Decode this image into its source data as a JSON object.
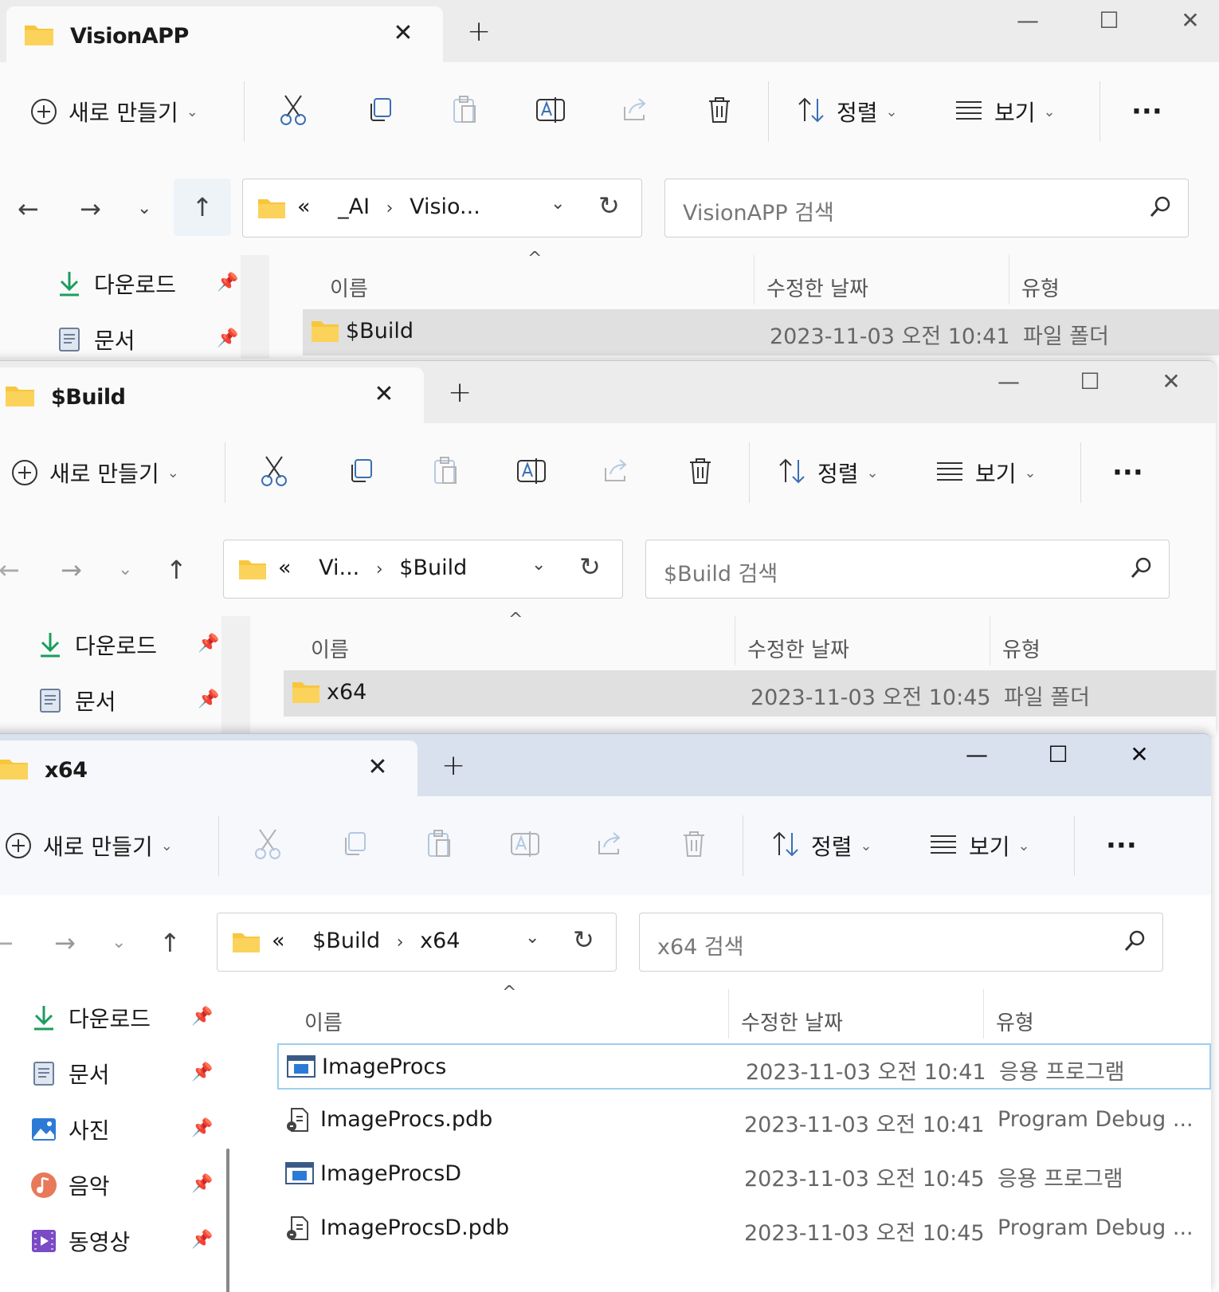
{
  "windows": [
    {
      "tab_title": "VisionAPP",
      "breadcrumb": [
        "_AI",
        "Visio..."
      ],
      "search_placeholder": "VisionAPP 검색",
      "rows": [
        {
          "name": "$Build",
          "date": "2023-11-03 오전 10:41",
          "type": "파일 폴더",
          "icon": "folder-icon"
        }
      ]
    },
    {
      "tab_title": "$Build",
      "breadcrumb": [
        "Vi...",
        "$Build"
      ],
      "search_placeholder": "$Build 검색",
      "rows": [
        {
          "name": "x64",
          "date": "2023-11-03 오전 10:45",
          "type": "파일 폴더",
          "icon": "folder-icon"
        }
      ]
    },
    {
      "tab_title": "x64",
      "breadcrumb": [
        "$Build",
        "x64"
      ],
      "search_placeholder": "x64 검색",
      "rows": [
        {
          "name": "ImageProcs",
          "date": "2023-11-03 오전 10:41",
          "type": "응용 프로그램",
          "icon": "application-icon"
        },
        {
          "name": "ImageProcs.pdb",
          "date": "2023-11-03 오전 10:41",
          "type": "Program Debug ...",
          "icon": "pdb-file-icon"
        },
        {
          "name": "ImageProcsD",
          "date": "2023-11-03 오전 10:45",
          "type": "응용 프로그램",
          "icon": "application-icon"
        },
        {
          "name": "ImageProcsD.pdb",
          "date": "2023-11-03 오전 10:45",
          "type": "Program Debug ...",
          "icon": "pdb-file-icon"
        }
      ]
    }
  ],
  "toolbar": {
    "new_label": "새로 만들기",
    "sort_label": "정렬",
    "view_label": "보기",
    "more_label": "···"
  },
  "address": {
    "overflow_label": "«"
  },
  "columns": {
    "name": "이름",
    "date": "수정한 날짜",
    "type": "유형"
  },
  "sidebar": {
    "items": [
      {
        "label": "다운로드",
        "icon": "download-icon"
      },
      {
        "label": "문서",
        "icon": "documents-icon"
      },
      {
        "label": "사진",
        "icon": "pictures-icon"
      },
      {
        "label": "음악",
        "icon": "music-icon"
      },
      {
        "label": "동영상",
        "icon": "videos-icon"
      }
    ]
  },
  "colors": {
    "folder": "#f8c63d",
    "download": "#1a9e5c",
    "accent_focus": "#9ccff0",
    "selection": "#e0e0e0",
    "active_tabstrip": "#d9e1ee"
  }
}
